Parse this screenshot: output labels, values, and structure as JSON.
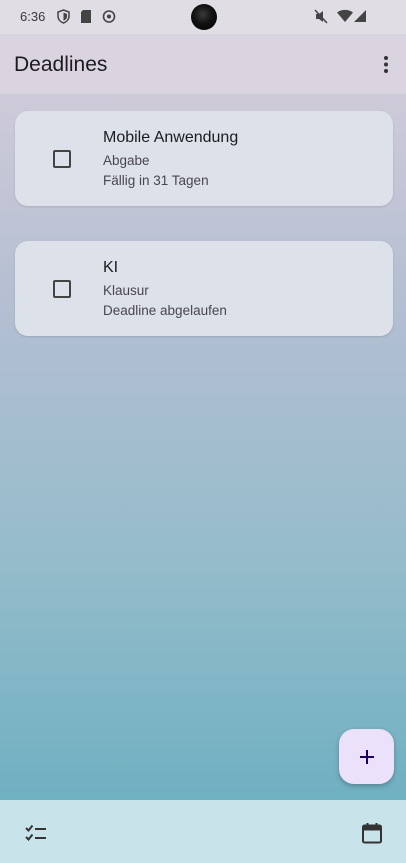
{
  "status_bar": {
    "time": "6:36",
    "left_icons": [
      "shield-icon",
      "sd-card-icon",
      "sync-icon"
    ],
    "right_icons": [
      "mute-icon",
      "wifi-icon",
      "signal-icon"
    ]
  },
  "app_bar": {
    "title": "Deadlines",
    "menu_icon": "more-vert-icon"
  },
  "deadlines": [
    {
      "title": "Mobile Anwendung",
      "type": "Abgabe",
      "due": "Fällig in 31 Tagen",
      "checked": false
    },
    {
      "title": "KI",
      "type": "Klausur",
      "due": "Deadline abgelaufen",
      "checked": false
    }
  ],
  "fab": {
    "icon": "add-icon",
    "label": "+"
  },
  "bottom_bar": {
    "left_icon": "checklist-icon",
    "right_icon": "calendar-icon"
  },
  "colors": {
    "app_bar": "#dad4e1",
    "card": "#dde2ea",
    "fab": "#ece1fa",
    "bottom_bar": "#c9e3eb"
  }
}
